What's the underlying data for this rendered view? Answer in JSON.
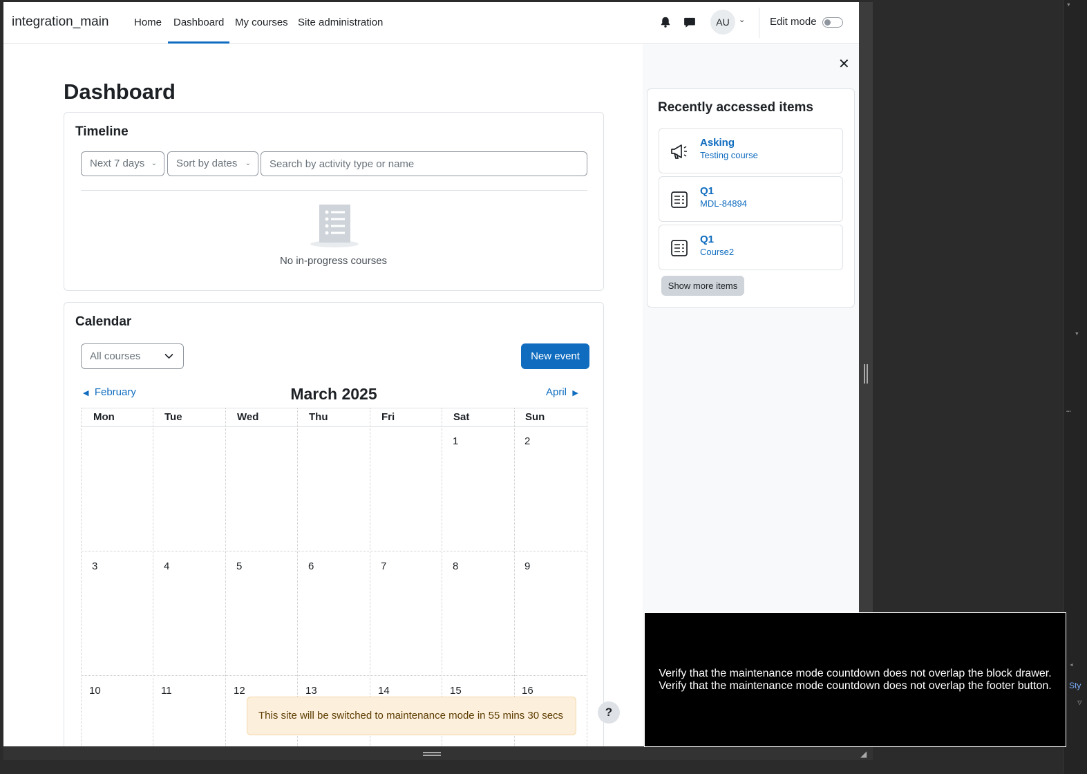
{
  "navbar": {
    "site_name": "integration_main",
    "links": [
      "Home",
      "Dashboard",
      "My courses",
      "Site administration"
    ],
    "active_link": "Dashboard",
    "avatar_initials": "AU",
    "edit_mode_label": "Edit mode",
    "edit_mode_on": false
  },
  "page": {
    "title": "Dashboard"
  },
  "timeline": {
    "title": "Timeline",
    "filter_label": "Next 7 days",
    "sort_label": "Sort by dates",
    "search_placeholder": "Search by activity type or name",
    "empty_text": "No in-progress courses"
  },
  "calendar": {
    "title": "Calendar",
    "course_filter": "All courses",
    "new_event_label": "New event",
    "prev_month": "February",
    "next_month": "April",
    "month_title": "March 2025",
    "weekdays": [
      "Mon",
      "Tue",
      "Wed",
      "Thu",
      "Fri",
      "Sat",
      "Sun"
    ],
    "weeks": [
      [
        "",
        "",
        "",
        "",
        "",
        "1",
        "2"
      ],
      [
        "3",
        "4",
        "5",
        "6",
        "7",
        "8",
        "9"
      ],
      [
        "10",
        "11",
        "12",
        "13",
        "14",
        "15",
        "16"
      ]
    ]
  },
  "drawer": {
    "recent_title": "Recently accessed items",
    "items": [
      {
        "name": "Asking",
        "course": "Testing course",
        "icon": "megaphone-icon"
      },
      {
        "name": "Q1",
        "course": "MDL-84894",
        "icon": "quiz-icon"
      },
      {
        "name": "Q1",
        "course": "Course2",
        "icon": "quiz-icon"
      }
    ],
    "show_more_label": "Show more items"
  },
  "maintenance": {
    "text": "This site will be switched to maintenance mode in 55 mins 30 secs"
  },
  "help": {
    "label": "?"
  },
  "overlay": {
    "lines": [
      "Verify that the maintenance mode countdown does not overlap the block drawer.",
      "Verify that the maintenance mode countdown does not overlap the footer button."
    ]
  },
  "devtools": {
    "tab_label": "Sty"
  },
  "colors": {
    "brand": "#0f6cbf",
    "warning_bg": "#fcefdc",
    "overlay_bg": "#000000"
  }
}
